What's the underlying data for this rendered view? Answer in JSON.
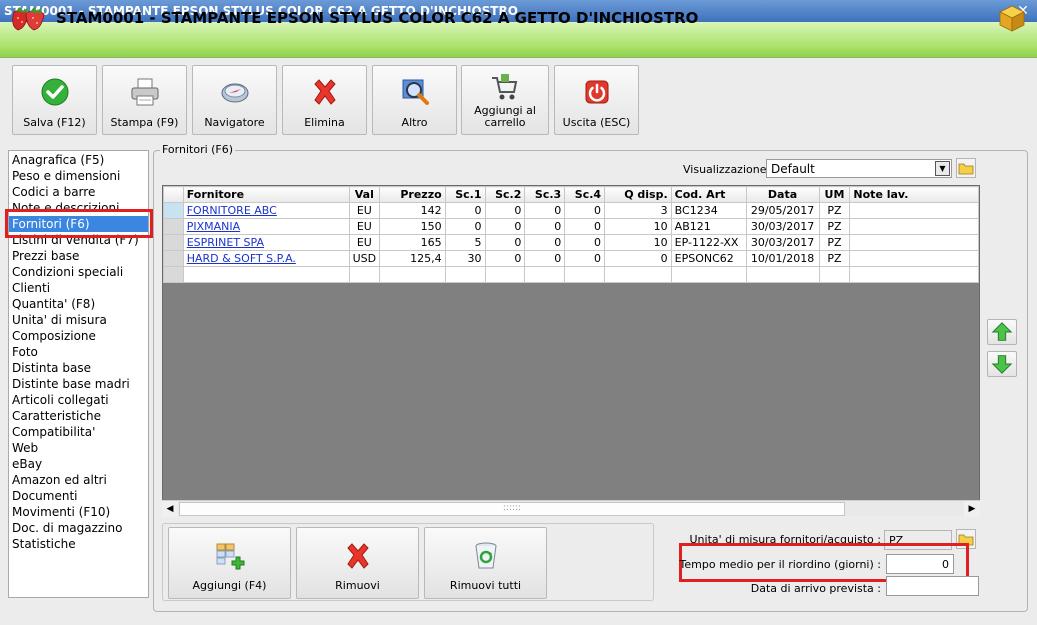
{
  "window": {
    "title": "STAM0001 - STAMPANTE EPSON STYLUS COLOR C62 A GETTO D'INCHIOSTRO",
    "close_glyph": "✕"
  },
  "header": {
    "title": "STAM0001 - STAMPANTE EPSON STYLUS COLOR C62 A GETTO D'INCHIOSTRO"
  },
  "toolbar": {
    "buttons": [
      {
        "label": "Salva (F12)",
        "icon": "check-icon"
      },
      {
        "label": "Stampa (F9)",
        "icon": "printer-icon"
      },
      {
        "label": "Navigatore",
        "icon": "compass-icon"
      },
      {
        "label": "Elimina",
        "icon": "red-x-icon"
      },
      {
        "label": "Altro",
        "icon": "magnifier-icon"
      },
      {
        "label": "Aggiungi al carrello",
        "icon": "cart-icon"
      },
      {
        "label": "Uscita (ESC)",
        "icon": "power-icon"
      }
    ]
  },
  "nav": {
    "items": [
      "Anagrafica (F5)",
      "Peso e dimensioni",
      "Codici a barre",
      "Note e descrizioni",
      "Fornitori (F6)",
      "Listini di vendita (F7)",
      "Prezzi base",
      "Condizioni speciali",
      "Clienti",
      "Quantita' (F8)",
      "Unita' di misura",
      "Composizione",
      "Foto",
      "Distinta base",
      "Distinte base madri",
      "Articoli collegati",
      "Caratteristiche",
      "Compatibilita'",
      "Web",
      "eBay",
      "Amazon ed altri",
      "Documenti",
      "Movimenti (F10)",
      "Doc. di magazzino",
      "Statistiche"
    ],
    "selected": "Fornitori (F6)"
  },
  "group": {
    "label": "Fornitori (F6)",
    "view_label": "Visualizzazione :",
    "view_value": "Default"
  },
  "grid": {
    "columns": [
      "Fornitore",
      "Val",
      "Prezzo",
      "Sc.1",
      "Sc.2",
      "Sc.3",
      "Sc.4",
      "Q disp.",
      "Cod. Art",
      "Data",
      "UM",
      "Note lav."
    ],
    "rows": [
      [
        "FORNITORE ABC",
        "EU",
        "142",
        "0",
        "0",
        "0",
        "0",
        "3",
        "BC1234",
        "29/05/2017",
        "PZ",
        ""
      ],
      [
        "PIXMANIA",
        "EU",
        "150",
        "0",
        "0",
        "0",
        "0",
        "10",
        "AB121",
        "30/03/2017",
        "PZ",
        ""
      ],
      [
        "ESPRINET SPA",
        "EU",
        "165",
        "5",
        "0",
        "0",
        "0",
        "10",
        "EP-1122-XX",
        "30/03/2017",
        "PZ",
        ""
      ],
      [
        "HARD & SOFT S.P.A.",
        "USD",
        "125,4",
        "30",
        "0",
        "0",
        "0",
        "0",
        "EPSONC62",
        "10/01/2018",
        "PZ",
        ""
      ]
    ],
    "scroll_thumb_grip": "::::::"
  },
  "bottom_buttons": [
    {
      "label": "Aggiungi (F4)",
      "icon": "add-grid-icon"
    },
    {
      "label": "Rimuovi",
      "icon": "red-x-icon"
    },
    {
      "label": "Rimuovi tutti",
      "icon": "recycle-bin-icon"
    }
  ],
  "fields": {
    "um_label": "Unita' di misura fornitori/acquisto :",
    "um_value": "PZ",
    "tempo_label": "Tempo medio per il riordino (giorni) :",
    "tempo_value": "0",
    "data_label": "Data di arrivo prevista :",
    "data_value": ""
  },
  "colors": {
    "title_bar": "#3e72bd",
    "header_green": "#a9e26a",
    "highlight_red": "#e02020",
    "selection_blue": "#3a86e0",
    "link_blue": "#1a33cc"
  }
}
